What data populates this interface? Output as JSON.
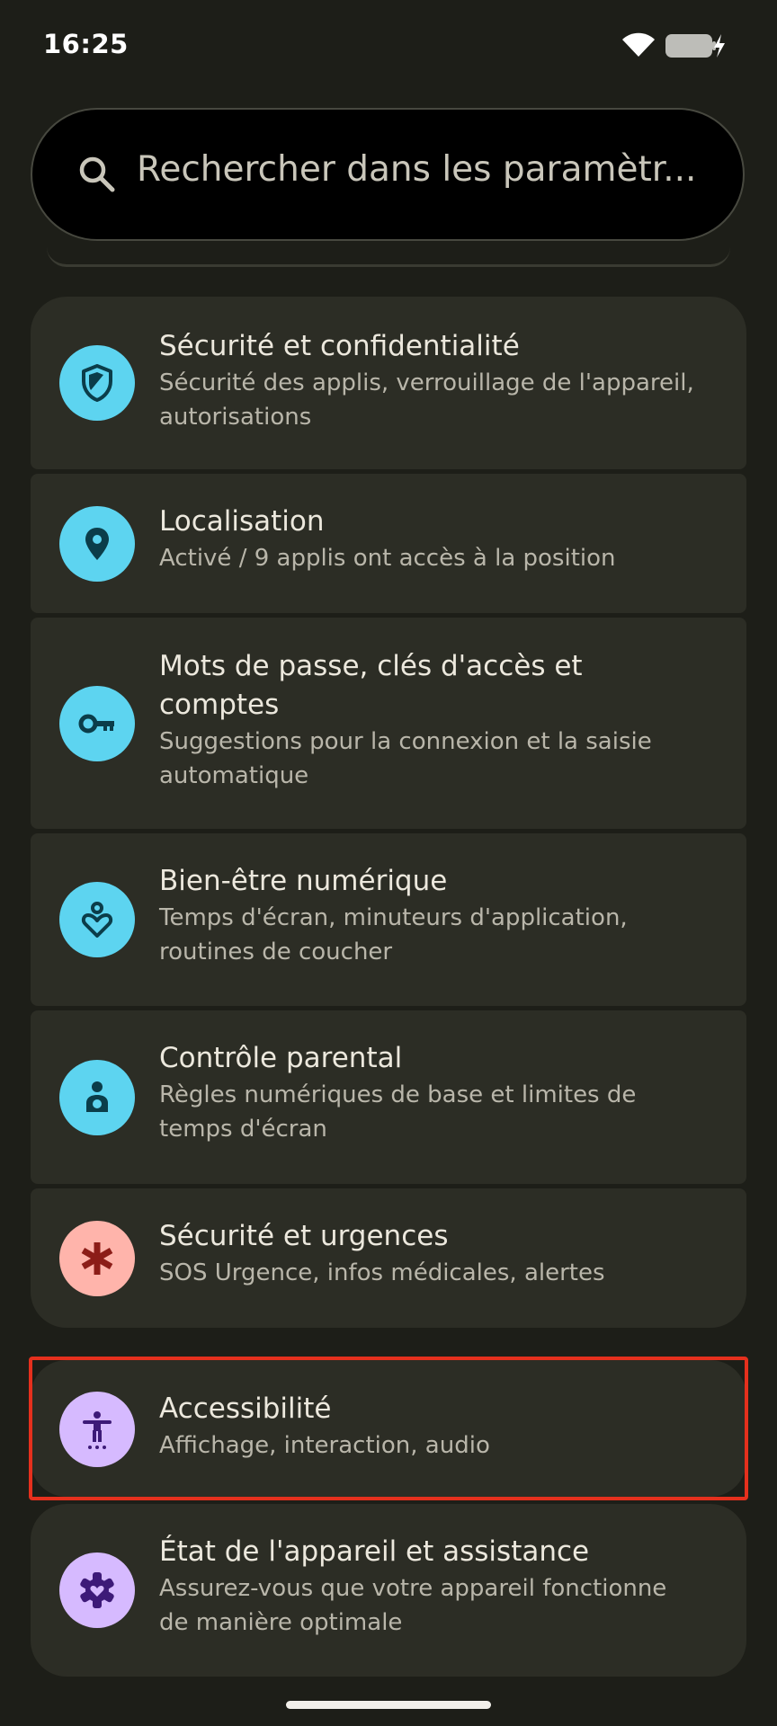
{
  "status_bar": {
    "time": "16:25",
    "wifi_icon": "wifi-icon",
    "battery_icon": "battery-charging-icon"
  },
  "search": {
    "placeholder": "Rechercher dans les paramètr...",
    "icon": "search-icon"
  },
  "settings": [
    {
      "title": "Sécurité et confidentialité",
      "subtitle_lines": [
        "Sécurité des applis, verrouillage de l'appareil,",
        "autorisations"
      ],
      "icon": "shield-icon",
      "icon_bg": "#5dd4f0",
      "icon_fg": "#0b3d4a"
    },
    {
      "title": "Localisation",
      "subtitle_lines": [
        "Activé / 9 applis ont accès à la position"
      ],
      "icon": "location-pin-icon",
      "icon_bg": "#5dd4f0",
      "icon_fg": "#0b3d4a"
    },
    {
      "title_lines": [
        "Mots de passe, clés d'accès et",
        "comptes"
      ],
      "subtitle_lines": [
        "Suggestions pour la connexion et la saisie",
        "automatique"
      ],
      "icon": "key-icon",
      "icon_bg": "#5dd4f0",
      "icon_fg": "#0b3d4a"
    },
    {
      "title": "Bien-être numérique",
      "subtitle_lines": [
        "Temps d'écran, minuteurs d'application,",
        "routines de coucher"
      ],
      "icon": "digital-wellbeing-icon",
      "icon_bg": "#5dd4f0",
      "icon_fg": "#0b3d4a"
    },
    {
      "title": "Contrôle parental",
      "subtitle_lines": [
        "Règles numériques de base et limites de",
        "temps d'écran"
      ],
      "icon": "parental-control-icon",
      "icon_bg": "#5dd4f0",
      "icon_fg": "#0b3d4a"
    },
    {
      "title": "Sécurité et urgences",
      "subtitle_lines": [
        "SOS Urgence, infos médicales, alertes"
      ],
      "icon": "emergency-asterisk-icon",
      "icon_bg": "#ffb4ab",
      "icon_fg": "#8c1d18"
    },
    {
      "title": "Accessibilité",
      "subtitle_lines": [
        "Affichage, interaction, audio"
      ],
      "icon": "accessibility-icon",
      "icon_bg": "#d6baff",
      "icon_fg": "#3d1a78"
    },
    {
      "title": "État de l'appareil et assistance",
      "subtitle_lines": [
        "Assurez-vous que votre appareil fonctionne",
        "de manière optimale"
      ],
      "icon": "device-health-icon",
      "icon_bg": "#d6baff",
      "icon_fg": "#3d1a78"
    }
  ],
  "highlight": {
    "color": "#e5301d",
    "target": "Accessibilité"
  }
}
